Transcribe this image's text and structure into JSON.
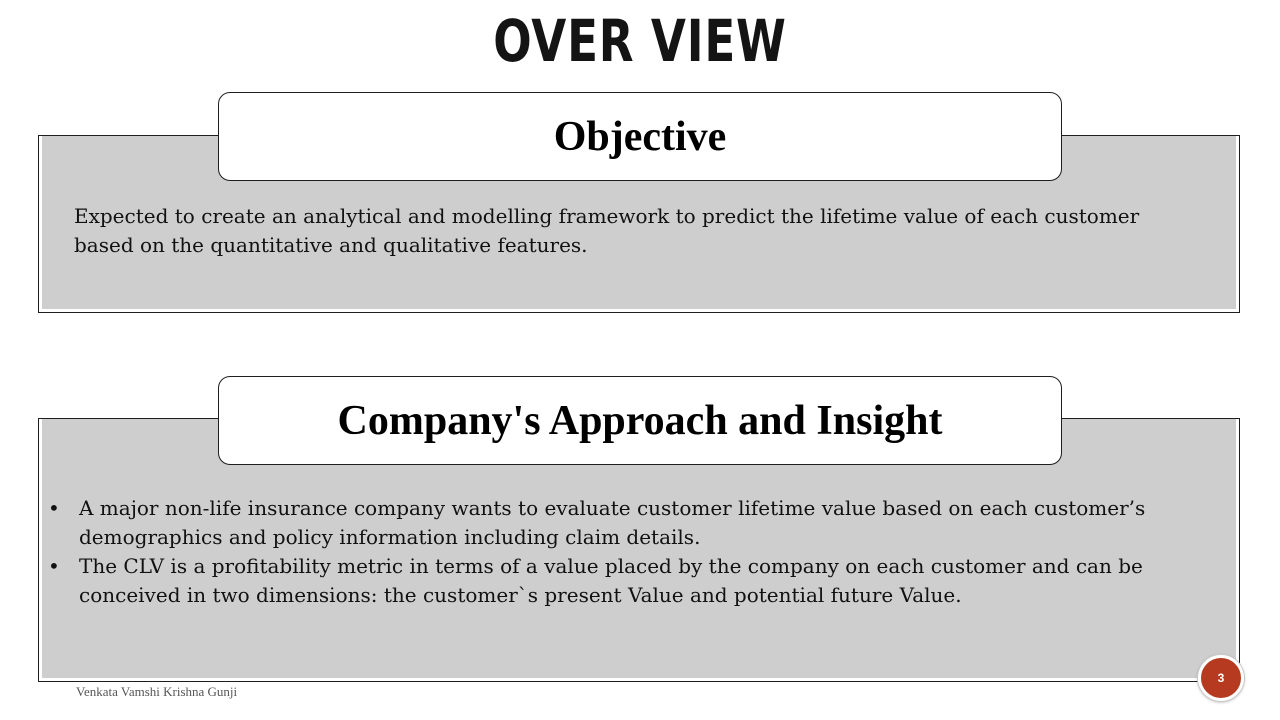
{
  "slide": {
    "title": "OVER VIEW",
    "footer_author": "Venkata Vamshi Krishna Gunji",
    "page_number": "3"
  },
  "objective": {
    "heading": "Objective",
    "text": "Expected to create an analytical and modelling framework to predict the lifetime value of each customer based on the quantitative and qualitative features."
  },
  "approach": {
    "heading": "Company's Approach and Insight",
    "bullet_symbol": "•",
    "bullets": [
      "A major non-life insurance company wants to evaluate customer lifetime value based on each customer’s demographics and policy information including claim details.",
      "The CLV is a profitability metric in terms of a value placed by the company on each customer and can be conceived in two dimensions: the customer`s present Value and potential future Value."
    ]
  },
  "colors": {
    "panel_fill": "#cecece",
    "badge_fill": "#b63a1f",
    "title_text": "#141414"
  }
}
